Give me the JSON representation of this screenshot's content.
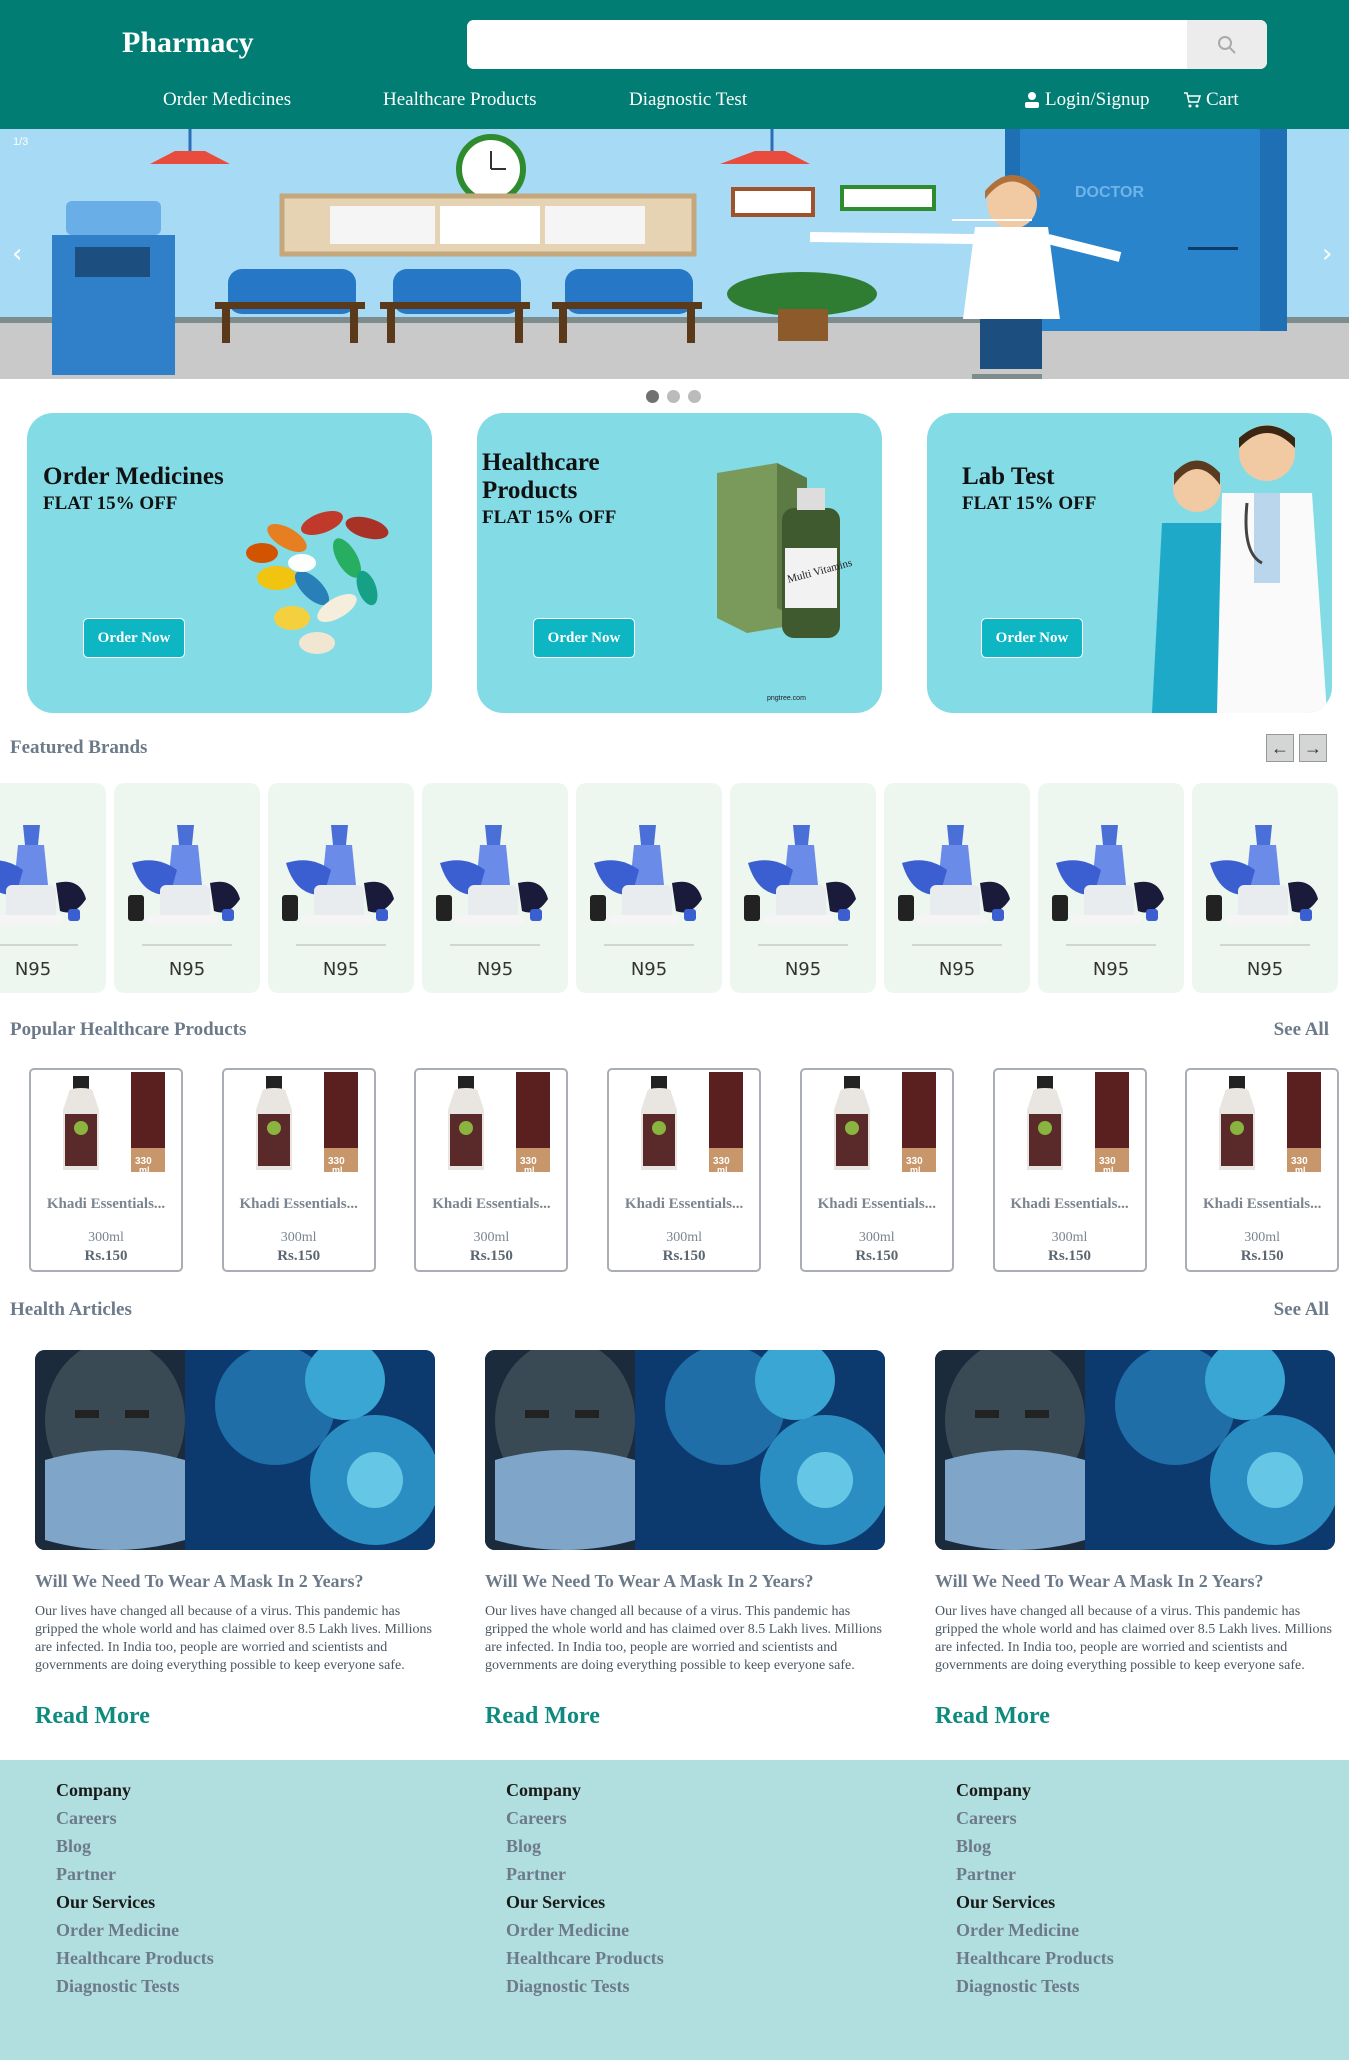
{
  "header": {
    "logo": "Pharmacy",
    "search_placeholder": "",
    "nav": [
      "Order Medicines",
      "Healthcare Products",
      "Diagnostic Test"
    ],
    "login": "Login/Signup",
    "cart": "Cart"
  },
  "banner": {
    "counter": "1/3",
    "door_label": "DOCTOR",
    "prev_arrow": "‹",
    "next_arrow": "›"
  },
  "promos": [
    {
      "title": "Order Medicines",
      "offer": "FLAT 15% OFF",
      "button": "Order Now"
    },
    {
      "title": "Healthcare Products",
      "offer": "FLAT 15% OFF",
      "button": "Order Now",
      "box_text": "Multi Vitamins",
      "footer_text": "pngtree.com"
    },
    {
      "title": "Lab Test",
      "offer": "FLAT 15% OFF",
      "button": "Order Now"
    }
  ],
  "brands": {
    "title": "Featured Brands",
    "items": [
      "N95",
      "N95",
      "N95",
      "N95",
      "N95",
      "N95",
      "N95",
      "N95",
      "N95"
    ]
  },
  "products": {
    "title": "Popular Healthcare Products",
    "see_all": "See All",
    "items": [
      {
        "name": "Khadi Essentials...",
        "size": "300ml",
        "price": "Rs.150"
      },
      {
        "name": "Khadi Essentials...",
        "size": "300ml",
        "price": "Rs.150"
      },
      {
        "name": "Khadi Essentials...",
        "size": "300ml",
        "price": "Rs.150"
      },
      {
        "name": "Khadi Essentials...",
        "size": "300ml",
        "price": "Rs.150"
      },
      {
        "name": "Khadi Essentials...",
        "size": "300ml",
        "price": "Rs.150"
      },
      {
        "name": "Khadi Essentials...",
        "size": "300ml",
        "price": "Rs.150"
      },
      {
        "name": "Khadi Essentials...",
        "size": "300ml",
        "price": "Rs.150"
      }
    ]
  },
  "articles": {
    "title": "Health Articles",
    "see_all": "See All",
    "items": [
      {
        "title": "Will We Need To Wear A Mask In 2 Years?",
        "text": "Our lives have changed all because of a virus. This pandemic has gripped the whole world and has claimed over 8.5 Lakh lives. Millions are infected. In India too, people are worried and scientists and governments are doing everything possible to keep everyone safe.",
        "link": "Read More"
      },
      {
        "title": "Will We Need To Wear A Mask In 2 Years?",
        "text": "Our lives have changed all because of a virus. This pandemic has gripped the whole world and has claimed over 8.5 Lakh lives. Millions are infected. In India too, people are worried and scientists and governments are doing everything possible to keep everyone safe.",
        "link": "Read More"
      },
      {
        "title": "Will We Need To Wear A Mask In 2 Years?",
        "text": "Our lives have changed all because of a virus. This pandemic has gripped the whole world and has claimed over 8.5 Lakh lives. Millions are infected. In India too, people are worried and scientists and governments are doing everything possible to keep everyone safe.",
        "link": "Read More"
      }
    ]
  },
  "footer": {
    "columns": [
      {
        "company_heading": "Company",
        "company_links": [
          "Careers",
          "Blog",
          "Partner"
        ],
        "services_heading": "Our Services",
        "services_links": [
          "Order Medicine",
          "Healthcare Products",
          "Diagnostic Tests"
        ]
      },
      {
        "company_heading": "Company",
        "company_links": [
          "Careers",
          "Blog",
          "Partner"
        ],
        "services_heading": "Our Services",
        "services_links": [
          "Order Medicine",
          "Healthcare Products",
          "Diagnostic Tests"
        ]
      },
      {
        "company_heading": "Company",
        "company_links": [
          "Careers",
          "Blog",
          "Partner"
        ],
        "services_heading": "Our Services",
        "services_links": [
          "Order Medicine",
          "Healthcare Products",
          "Diagnostic Tests"
        ]
      }
    ]
  },
  "colors": {
    "header": "#017d73",
    "promo_bg": "#83dbe6",
    "button": "#0eb5c3",
    "footer": "#b1dfdf",
    "link": "#0e8a7f"
  },
  "icons": [
    "search-icon",
    "user-icon",
    "cart-icon",
    "chevron-left-icon",
    "chevron-right-icon",
    "arrow-left-icon",
    "arrow-right-icon"
  ]
}
